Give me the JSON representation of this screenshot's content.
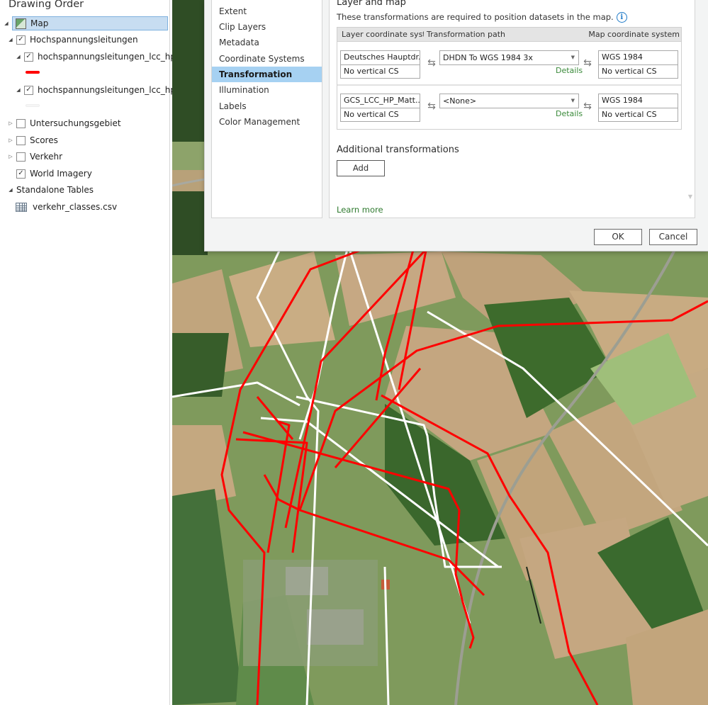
{
  "toc": {
    "title": "Drawing Order",
    "items": [
      {
        "label": "Map",
        "type": "map",
        "expanded": true,
        "selected": true
      },
      {
        "label": "Hochspannungsleitungen",
        "type": "group",
        "checked": true,
        "expanded": true
      },
      {
        "label": "hochspannungsleitungen_lcc_hp",
        "type": "layer",
        "checked": true,
        "expanded": true,
        "symbol_color": "#ff0000"
      },
      {
        "label": "hochspannungsleitungen_lcc_hp",
        "type": "layer",
        "checked": true,
        "expanded": true,
        "symbol_color": "#ffffff"
      },
      {
        "label": "Untersuchungsgebiet",
        "type": "group",
        "checked": false,
        "expanded": false
      },
      {
        "label": "Scores",
        "type": "group",
        "checked": false,
        "expanded": false
      },
      {
        "label": "Verkehr",
        "type": "group",
        "checked": false,
        "expanded": false
      },
      {
        "label": "World Imagery",
        "type": "basemap",
        "checked": true
      },
      {
        "label": "Standalone Tables",
        "type": "header",
        "expanded": true
      },
      {
        "label": "verkehr_classes.csv",
        "type": "table"
      }
    ],
    "check_glyph": "✓"
  },
  "dialog": {
    "nav": [
      {
        "label": "Extent"
      },
      {
        "label": "Clip Layers"
      },
      {
        "label": "Metadata"
      },
      {
        "label": "Coordinate Systems"
      },
      {
        "label": "Transformation",
        "active": true
      },
      {
        "label": "Illumination"
      },
      {
        "label": "Labels"
      },
      {
        "label": "Color Management"
      }
    ],
    "section_title": "Layer and map",
    "help_text": "These transformations are required to position datasets in the map.",
    "info_icon": "i",
    "grid": {
      "headers": [
        "Layer coordinate system",
        "Transformation path",
        "Map coordinate system"
      ],
      "rows": [
        {
          "layer_cs": "Deutsches Hauptdr...",
          "layer_vcs": "No vertical CS",
          "path": "DHDN To WGS 1984 3x",
          "details": "Details",
          "map_cs": "WGS 1984",
          "map_vcs": "No vertical CS"
        },
        {
          "layer_cs": "GCS_LCC_HP_Matt...",
          "layer_vcs": "No vertical CS",
          "path": "<None>",
          "details": "Details",
          "map_cs": "WGS 1984",
          "map_vcs": "No vertical CS"
        }
      ]
    },
    "additional_title": "Additional transformations",
    "add_label": "Add",
    "learn_more": "Learn more",
    "ok_label": "OK",
    "cancel_label": "Cancel",
    "swap_glyph": "⇆",
    "caret_glyph": "▼",
    "scroll_glyph": "▼"
  },
  "map": {
    "basemap": "World Imagery",
    "line_colors": {
      "layer_red": "#ff0000",
      "layer_white": "#ffffff"
    }
  }
}
